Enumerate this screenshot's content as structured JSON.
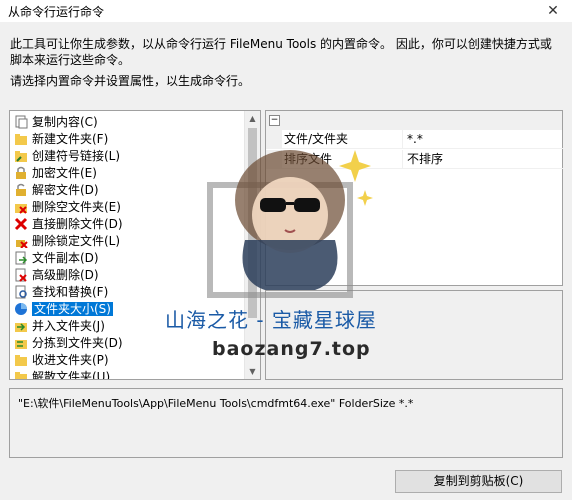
{
  "window": {
    "title": "从命令行运行命令",
    "close_icon": "✕"
  },
  "description": "此工具可让你生成参数，以从命令行运行 FileMenu Tools 的内置命令。 因此，你可以创建快捷方式或脚本来运行这些命令。",
  "hint": "请选择内置命令并设置属性，以生成命令行。",
  "commands": [
    {
      "label": "复制内容(C)",
      "icon": "copy-content-icon"
    },
    {
      "label": "新建文件夹(F)",
      "icon": "new-folder-icon"
    },
    {
      "label": "创建符号链接(L)",
      "icon": "symlink-icon"
    },
    {
      "label": "加密文件(E)",
      "icon": "encrypt-icon"
    },
    {
      "label": "解密文件(D)",
      "icon": "decrypt-icon"
    },
    {
      "label": "删除空文件夹(E)",
      "icon": "delete-empty-folder-icon"
    },
    {
      "label": "直接删除文件(D)",
      "icon": "delete-icon"
    },
    {
      "label": "删除锁定文件(L)",
      "icon": "delete-locked-icon"
    },
    {
      "label": "文件副本(D)",
      "icon": "duplicate-file-icon"
    },
    {
      "label": "高级删除(D)",
      "icon": "advanced-delete-icon"
    },
    {
      "label": "查找和替换(F)",
      "icon": "find-replace-icon"
    },
    {
      "label": "文件夹大小(S)",
      "icon": "folder-size-icon",
      "selected": true
    },
    {
      "label": "并入文件夹(J)",
      "icon": "join-folder-icon"
    },
    {
      "label": "分拣到文件夹(D)",
      "icon": "sort-to-folder-icon"
    },
    {
      "label": "收进文件夹(P)",
      "icon": "pack-folder-icon"
    },
    {
      "label": "解散文件夹(U)",
      "icon": "unpack-folder-icon"
    }
  ],
  "properties": {
    "toggle": "⊟",
    "rows": [
      {
        "name": "文件/文件夹",
        "value": "*.*"
      },
      {
        "name": "排序文件",
        "value": "不排序"
      }
    ]
  },
  "command_line": "\"E:\\软件\\FileMenuTools\\App\\FileMenu Tools\\cmdfmt64.exe\" FolderSize  *.*",
  "copy_button": "复制到剪贴板(C)",
  "watermark": {
    "text": "山海之花 - 宝藏星球屋",
    "url": "baozang7.top"
  },
  "colors": {
    "selection": "#0078d7",
    "watermark_blue": "#1a5aa6"
  }
}
